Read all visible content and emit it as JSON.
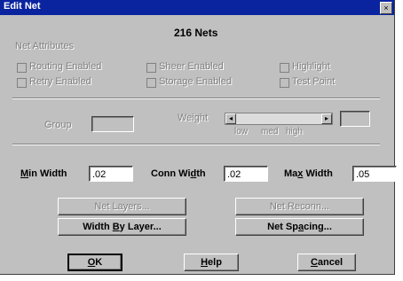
{
  "window": {
    "title": "Edit Net",
    "close_glyph": "×"
  },
  "header": {
    "net_count": "216 Nets"
  },
  "net_attributes": {
    "group_label": "Net Attributes",
    "checkboxes": [
      {
        "label": "Routing Enabled",
        "checked": false
      },
      {
        "label": "Sheer Enabled",
        "checked": false
      },
      {
        "label": "Highlight",
        "checked": false
      },
      {
        "label": "Retry Enabled",
        "checked": false
      },
      {
        "label": "Storage Enabled",
        "checked": false
      },
      {
        "label": "Test Point",
        "checked": false
      }
    ]
  },
  "group": {
    "label": "Group",
    "value": ""
  },
  "weight": {
    "label": "Weight",
    "low": "low",
    "med": "med",
    "high": "high",
    "value": ""
  },
  "widths": {
    "min": {
      "prefix": "M",
      "rest": "in Width",
      "value": ".02"
    },
    "conn": {
      "pre": "Conn Wi",
      "acc": "d",
      "post": "th",
      "value": ".02"
    },
    "max": {
      "pre": "Ma",
      "acc": "x",
      "post": " Width",
      "value": ".05"
    }
  },
  "buttons": {
    "net_layers": "Net Layers...",
    "net_reconn": "Net Reconn...",
    "width_by_layer": {
      "pre": "Width ",
      "acc": "B",
      "post": "y Layer..."
    },
    "net_spacing": {
      "pre": "Net Sp",
      "acc": "a",
      "post": "cing..."
    },
    "ok": {
      "acc": "O",
      "post": "K"
    },
    "help": {
      "acc": "H",
      "post": "elp"
    },
    "cancel": {
      "acc": "C",
      "post": "ancel"
    }
  },
  "colors": {
    "titlebar": "#0a24a0",
    "face": "#c0c0c0",
    "disabled_text": "#808080"
  }
}
